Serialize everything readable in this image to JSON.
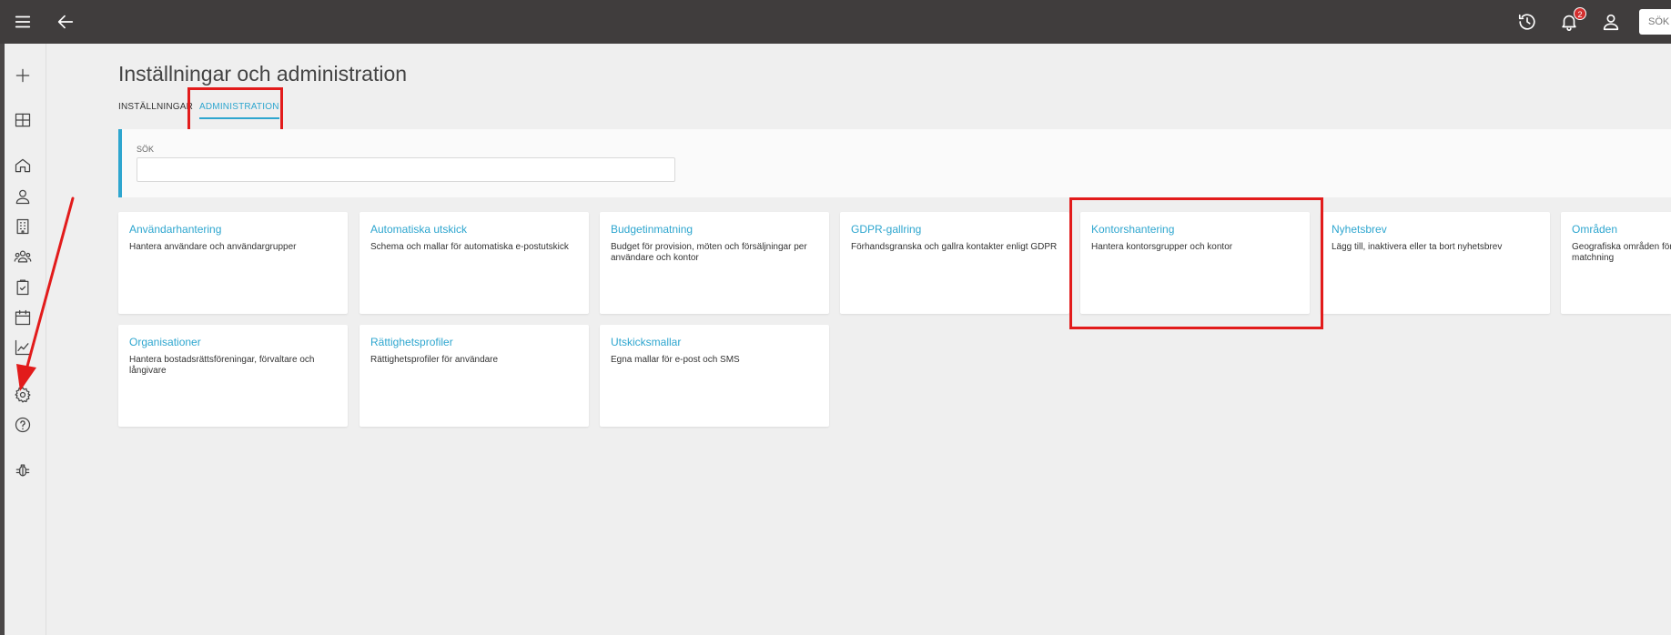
{
  "topbar": {
    "search_label": "SÖK",
    "notification_count": "2"
  },
  "page": {
    "title": "Inställningar och administration"
  },
  "tabs": {
    "settings": "INSTÄLLNINGAR",
    "admin": "ADMINISTRATION"
  },
  "search": {
    "label": "SÖK",
    "value": ""
  },
  "cards": [
    {
      "title": "Användarhantering",
      "desc": "Hantera användare och användargrupper"
    },
    {
      "title": "Automatiska utskick",
      "desc": "Schema och mallar för automatiska e-postutskick"
    },
    {
      "title": "Budgetinmatning",
      "desc": "Budget för provision, möten och försäljningar per användare och kontor"
    },
    {
      "title": "GDPR-gallring",
      "desc": "Förhandsgranska och gallra kontakter enligt GDPR"
    },
    {
      "title": "Kontorshantering",
      "desc": "Hantera kontorsgrupper och kontor"
    },
    {
      "title": "Nyhetsbrev",
      "desc": "Lägg till, inaktivera eller ta bort nyhetsbrev"
    },
    {
      "title": "Områden",
      "desc": "Geografiska områden för matchning"
    },
    {
      "title": "Organisationer",
      "desc": "Hantera bostadsrättsföreningar, förvaltare och långivare"
    },
    {
      "title": "Rättighetsprofiler",
      "desc": "Rättighetsprofiler för användare"
    },
    {
      "title": "Utskicksmallar",
      "desc": "Egna mallar för e-post och SMS"
    }
  ],
  "colors": {
    "accent": "#2ea6cf",
    "topbar": "#403d3d",
    "highlight": "#e21b1b",
    "badge": "#d32f2f"
  }
}
